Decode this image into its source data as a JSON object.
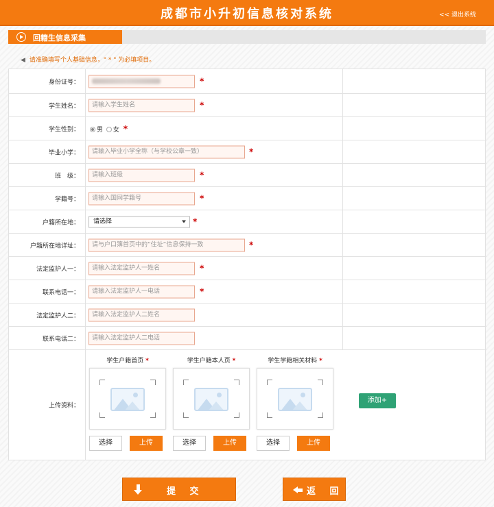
{
  "header": {
    "title": "成都市小升初信息核对系统",
    "logout": "<< 退出系统"
  },
  "section": {
    "tab_label": "回籍生信息采集"
  },
  "notice": {
    "text": "请准确填写个人基础信息，\" * \" 为必填项目。"
  },
  "form": {
    "required_mark": "*",
    "fields": [
      {
        "label": "身份证号：",
        "placeholder": ""
      },
      {
        "label": "学生姓名：",
        "placeholder": "请输入学生姓名"
      },
      {
        "label": "学生性别：",
        "options": [
          "男",
          "女"
        ],
        "selected": "男"
      },
      {
        "label": "毕业小学：",
        "placeholder": "请输入毕业小学全称（与学校公章一致）"
      },
      {
        "label": "班　级：",
        "placeholder": "请输入班级"
      },
      {
        "label": "学籍号：",
        "placeholder": "请输入国网学籍号"
      },
      {
        "label": "户籍所在地：",
        "selected": "请选择"
      },
      {
        "label": "户籍所在地详址：",
        "placeholder": "请与户口簿首页中的“住址”信息保持一致"
      },
      {
        "label": "法定监护人一：",
        "placeholder": "请输入法定监护人一姓名"
      },
      {
        "label": "联系电话一：",
        "placeholder": "请输入法定监护人一电话"
      },
      {
        "label": "法定监护人二：",
        "placeholder": "请输入法定监护人二姓名"
      },
      {
        "label": "联系电话二：",
        "placeholder": "请输入法定监护人二电话"
      }
    ],
    "upload": {
      "label": "上传资料：",
      "items": [
        {
          "title": "学生户籍首页"
        },
        {
          "title": "学生户籍本人页"
        },
        {
          "title": "学生学籍相关材料"
        }
      ],
      "choose_label": "选择",
      "upload_label": "上传",
      "add_label": "添加+"
    }
  },
  "actions": {
    "submit": "提 交",
    "back": "返 回"
  },
  "colors": {
    "accent": "#f47a10",
    "add_button": "#2fa275",
    "required": "#cc0000"
  },
  "icons": [
    "play-circle-icon",
    "speaker-icon",
    "image-placeholder-icon",
    "arrow-down-icon",
    "arrow-left-icon",
    "select-caret-icon"
  ]
}
